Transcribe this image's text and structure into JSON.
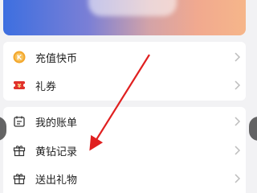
{
  "section1": {
    "items": [
      {
        "label": "充值快币",
        "icon": "coin-icon",
        "icon_glyph": "K"
      },
      {
        "label": "礼券",
        "icon": "coupon-icon",
        "icon_glyph": "¥"
      }
    ]
  },
  "section2": {
    "items": [
      {
        "label": "我的账单",
        "icon": "bill-icon"
      },
      {
        "label": "黄钻记录",
        "icon": "gift-box-icon"
      },
      {
        "label": "送出礼物",
        "icon": "gift-icon"
      }
    ]
  },
  "colors": {
    "accent_orange": "#f3a62b",
    "coupon_red": "#e0312b",
    "annotation_red": "#e02020"
  }
}
